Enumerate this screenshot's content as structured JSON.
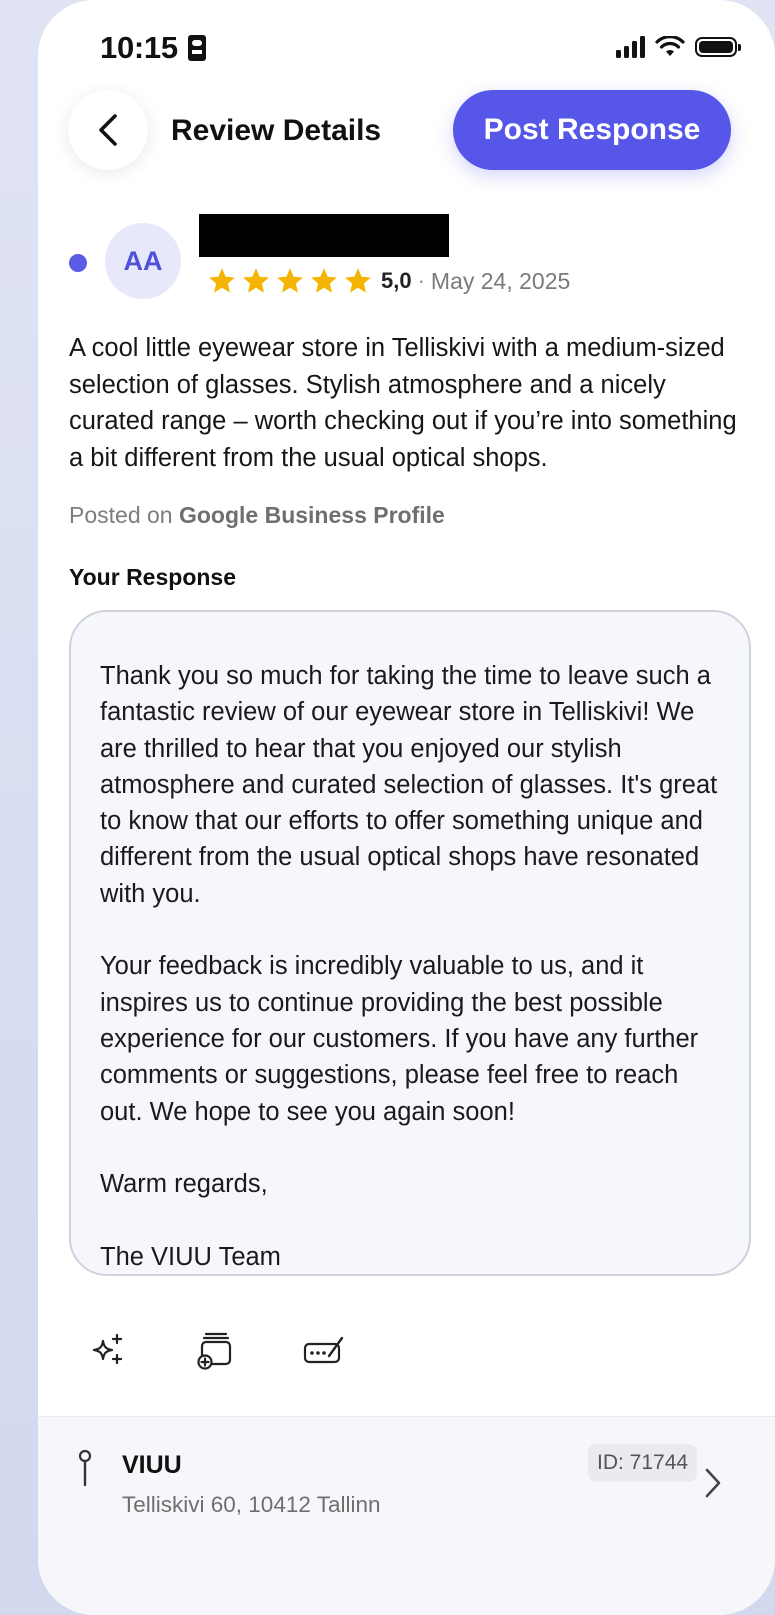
{
  "status_bar": {
    "time": "10:15",
    "id_icon": "id-card-icon",
    "signal_icon": "cellular-signal-icon",
    "wifi_icon": "wifi-icon",
    "battery_icon": "battery-icon"
  },
  "header": {
    "back_icon": "chevron-left-icon",
    "title": "Review Details",
    "post_button_label": "Post Response"
  },
  "review": {
    "avatar_initials": "AA",
    "stars": 5,
    "rating": "5,0",
    "separator": "·",
    "date": "May 24, 2025",
    "text": "A cool little eyewear store in Telliskivi with a medium-sized selection of glasses. Stylish atmosphere and a nicely curated range – worth checking out if you’re into something a bit different from the usual optical shops.",
    "posted_on_prefix": "Posted on",
    "platform": "Google Business Profile"
  },
  "response": {
    "label": "Your Response",
    "paragraphs": [
      "Thank you so much for taking the time to leave such a fantastic review of our eyewear store in Telliskivi! We are thrilled to hear that you enjoyed our stylish atmosphere and curated selection of glasses. It's great to know that our efforts to offer something unique and different from the usual optical shops have resonated with you.",
      "Your feedback is incredibly valuable to us, and it inspires us to continue providing the best possible experience for our customers. If you have any further comments or suggestions, please feel free to reach out. We hope to see you again soon!",
      "Warm regards,",
      "The VIUU Team"
    ]
  },
  "tools": [
    {
      "icon": "ai-sparkle-icon"
    },
    {
      "icon": "add-template-icon"
    },
    {
      "icon": "signature-icon"
    }
  ],
  "location": {
    "pin_icon": "pin-icon",
    "name": "VIUU",
    "address": "Telliskivi 60, 10412 Tallinn",
    "id": "ID: 71744",
    "chevron_icon": "chevron-right-icon"
  },
  "colors": {
    "accent": "#5656e8",
    "star": "#f5b400",
    "avatar_bg": "#e8e8fb"
  }
}
